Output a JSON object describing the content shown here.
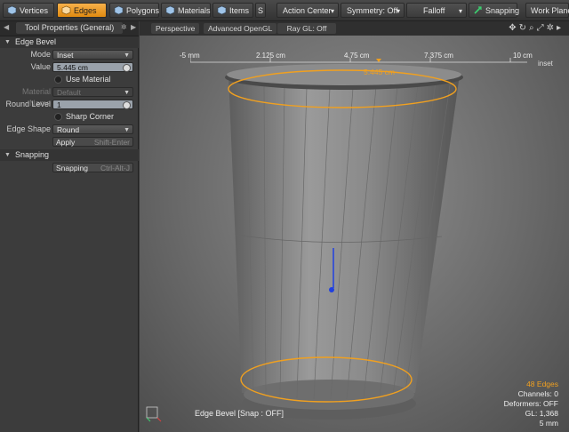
{
  "toolbar": {
    "vertices": "Vertices",
    "edges": "Edges",
    "polygons": "Polygons",
    "materials": "Materials",
    "items": "Items",
    "s": "S",
    "action_center": "Action Center",
    "symmetry": "Symmetry: Off",
    "falloff": "Falloff",
    "snapping": "Snapping",
    "work_plane": "Work Plane",
    "accent": "#f0a030"
  },
  "panel": {
    "title": "Tool Properties (General)",
    "edge_bevel_section": "Edge Bevel",
    "mode_label": "Mode",
    "mode_value": "Inset",
    "value_label": "Value",
    "value_value": "5.445 cm",
    "use_material": "Use Material",
    "material_name_label": "Material Name",
    "material_name_value": "Default",
    "round_level_label": "Round Level",
    "round_level_value": "1",
    "sharp_corner": "Sharp Corner",
    "edge_shape_label": "Edge Shape",
    "edge_shape_value": "Round",
    "apply_label": "Apply",
    "apply_shortcut": "Shift-Enter",
    "snapping_section": "Snapping",
    "snapping_label": "Snapping",
    "snapping_shortcut": "Ctrl-Alt-J"
  },
  "viewport": {
    "tab_perspective": "Perspective",
    "tab_opengl": "Advanced OpenGL",
    "tab_raygl": "Ray GL: Off",
    "ruler_ticks": [
      "-5 mm",
      "2.125 cm",
      "4.75 cm",
      "7.375 cm",
      "10 cm"
    ],
    "ruler_value": "5.445 cm",
    "ruler_unit": "inset",
    "stats": {
      "edges": "48 Edges",
      "channels": "Channels: 0",
      "deformers": "Deformers: OFF",
      "gl": "GL: 1,368",
      "scale": "5 mm"
    },
    "status": "Edge Bevel  [Snap : OFF]",
    "selection_color": "#f0a020",
    "handle_color": "#2040e0"
  }
}
